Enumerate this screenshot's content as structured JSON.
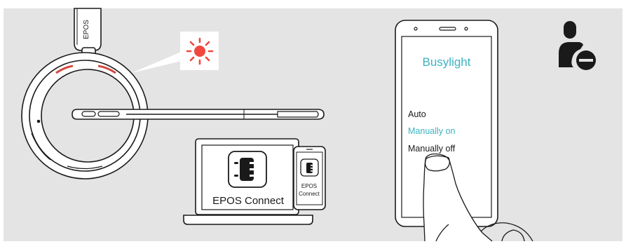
{
  "headset": {
    "brand_text": "EPOS"
  },
  "app": {
    "name": "EPOS Connect",
    "phone_name_line1": "EPOS",
    "phone_name_line2": "Connect"
  },
  "phone_screen": {
    "title": "Busylight",
    "options": [
      {
        "label": "Auto",
        "state": "normal"
      },
      {
        "label": "Manually on",
        "state": "selected"
      },
      {
        "label": "Manually off",
        "state": "normal"
      }
    ]
  },
  "colors": {
    "accent": "#3bb3c3",
    "busylight_red": "#f0483e",
    "background": "#e4e4e4",
    "line": "#1a1a1a"
  },
  "icons": [
    "busylight-icon",
    "epos-connect-app-icon",
    "user-busy-icon",
    "finger-tap-icon"
  ]
}
